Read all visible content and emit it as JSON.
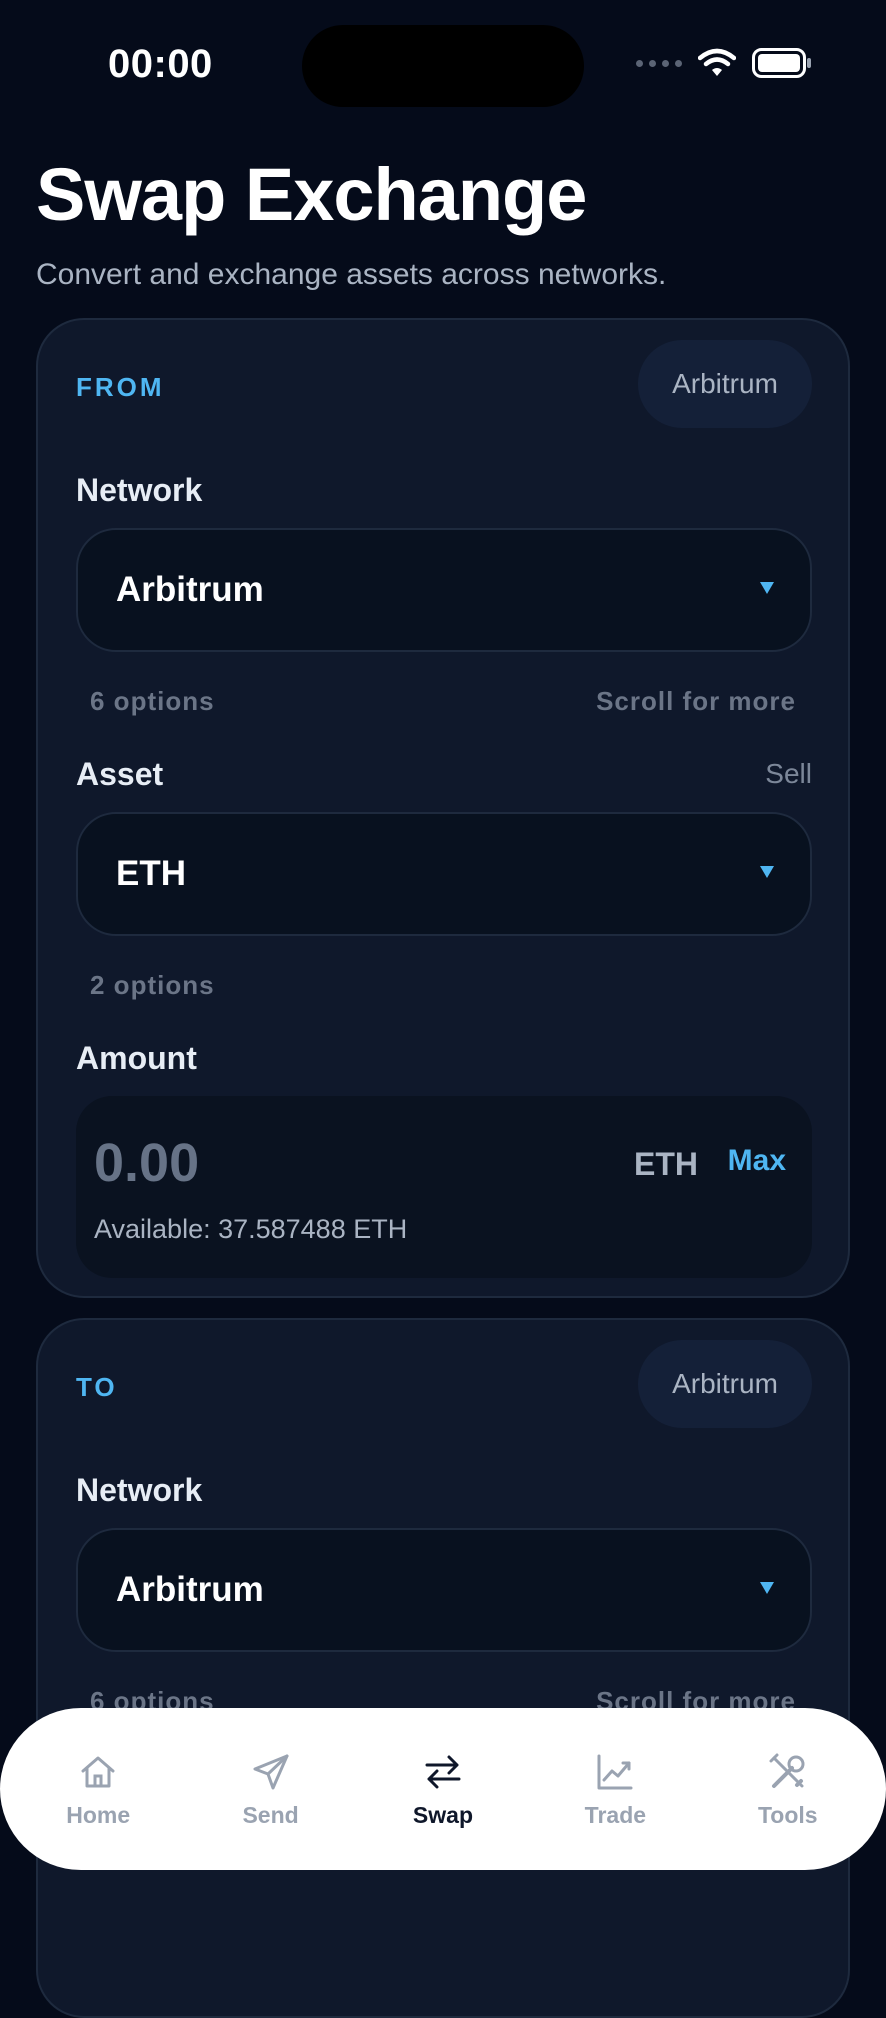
{
  "status_bar": {
    "time": "00:00"
  },
  "header": {
    "title": "Swap Exchange",
    "subtitle": "Convert and exchange assets across networks."
  },
  "from_card": {
    "label": "FROM",
    "network_chip": "Arbitrum",
    "network": {
      "label": "Network",
      "value": "Arbitrum",
      "options_count": "6 options",
      "scroll_hint": "Scroll for more"
    },
    "asset": {
      "label": "Asset",
      "side_label": "Sell",
      "value": "ETH",
      "options_count": "2 options"
    },
    "amount": {
      "label": "Amount",
      "value": "0.00",
      "asset": "ETH",
      "max_label": "Max",
      "available": "Available: 37.587488 ETH"
    }
  },
  "to_card": {
    "label": "TO",
    "network_chip": "Arbitrum",
    "network": {
      "label": "Network",
      "value": "Arbitrum",
      "options_count": "6 options",
      "scroll_hint": "Scroll for more"
    }
  },
  "bottom_nav": {
    "items": [
      {
        "label": "Home",
        "icon": "home-icon"
      },
      {
        "label": "Send",
        "icon": "send-icon"
      },
      {
        "label": "Swap",
        "icon": "swap-icon",
        "active": true
      },
      {
        "label": "Trade",
        "icon": "trade-chart-icon"
      },
      {
        "label": "Tools",
        "icon": "tools-icon"
      }
    ]
  },
  "colors": {
    "background": "#050b1a",
    "card": "#0f182b",
    "accent": "#4fb6f2",
    "nav_background": "#ffffff"
  }
}
